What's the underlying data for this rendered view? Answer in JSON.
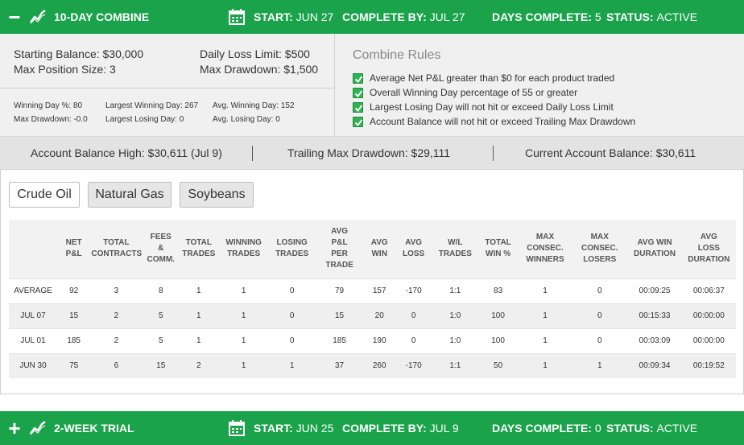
{
  "combine": {
    "title": "10-DAY COMBINE",
    "toggle_icon": "minus",
    "start_label": "START:",
    "start_value": "JUN 27",
    "complete_label": "COMPLETE BY:",
    "complete_value": "JUL 27",
    "days_label": "DAYS COMPLETE:",
    "days_value": "5",
    "status_label": "STATUS:",
    "status_value": "ACTIVE",
    "accent_color": "#1aa34a"
  },
  "summary": {
    "starting_balance": "Starting Balance: $30,000",
    "max_position_size": "Max Position Size: 3",
    "daily_loss_limit": "Daily Loss Limit: $500",
    "max_drawdown": "Max Drawdown: $1,500",
    "winning_day_pct": "Winning Day %: 80",
    "max_drawdown_small": "Max Drawdown: -0.0",
    "largest_winning_day": "Largest Winning Day: 267",
    "largest_losing_day": "Largest Losing Day: 0",
    "avg_winning_day": "Avg. Winning Day: 152",
    "avg_losing_day": "Avg. Losing Day: 0"
  },
  "rules": {
    "title": "Combine Rules",
    "items": [
      "Average Net P&L greater than $0 for each product traded",
      "Overall Winning Day percentage of 55 or greater",
      "Largest Losing Day will not hit or exceed Daily Loss Limit",
      "Account Balance will not hit or exceed Trailing Max Drawdown"
    ]
  },
  "balances": {
    "high": "Account Balance High: $30,611 (Jul 9)",
    "trailing": "Trailing Max Drawdown: $29,111",
    "current": "Current Account Balance: $30,611"
  },
  "products": [
    "Crude Oil",
    "Natural Gas",
    "Soybeans"
  ],
  "table": {
    "headers": [
      [
        "",
        ""
      ],
      [
        "NET",
        "P&L"
      ],
      [
        "TOTAL",
        "CONTRACTS"
      ],
      [
        "FEES",
        "&",
        "COMM."
      ],
      [
        "TOTAL",
        "TRADES"
      ],
      [
        "WINNING",
        "TRADES"
      ],
      [
        "LOSING",
        "TRADES"
      ],
      [
        "AVG",
        "P&L",
        "PER",
        "TRADE"
      ],
      [
        "AVG",
        "WIN"
      ],
      [
        "AVG",
        "LOSS"
      ],
      [
        "W/L",
        "TRADES"
      ],
      [
        "TOTAL",
        "WIN %"
      ],
      [
        "MAX",
        "CONSEC.",
        "WINNERS"
      ],
      [
        "MAX",
        "CONSEC.",
        "LOSERS"
      ],
      [
        "AVG WIN",
        "DURATION"
      ],
      [
        "AVG",
        "LOSS",
        "DURATION"
      ]
    ],
    "rows": [
      [
        "AVERAGE",
        "92",
        "3",
        "8",
        "1",
        "1",
        "0",
        "79",
        "157",
        "-170",
        "1:1",
        "83",
        "1",
        "0",
        "00:09:25",
        "00:06:37"
      ],
      [
        "JUL 07",
        "15",
        "2",
        "5",
        "1",
        "1",
        "0",
        "15",
        "20",
        "0",
        "1:0",
        "100",
        "1",
        "0",
        "00:15:33",
        "00:00:00"
      ],
      [
        "JUL 01",
        "185",
        "2",
        "5",
        "1",
        "1",
        "0",
        "185",
        "190",
        "0",
        "1:0",
        "100",
        "1",
        "0",
        "00:03:09",
        "00:00:00"
      ],
      [
        "JUN 30",
        "75",
        "6",
        "15",
        "2",
        "1",
        "1",
        "37",
        "260",
        "-170",
        "1:1",
        "50",
        "1",
        "1",
        "00:09:34",
        "00:19:52"
      ]
    ]
  },
  "trial": {
    "title": "2-WEEK TRIAL",
    "toggle_icon": "plus",
    "start_label": "START:",
    "start_value": "JUN 25",
    "complete_label": "COMPLETE BY:",
    "complete_value": "JUL 9",
    "days_label": "DAYS COMPLETE:",
    "days_value": "0",
    "status_label": "STATUS:",
    "status_value": "ACTIVE"
  },
  "icons": {
    "trend": "trend-line-icon",
    "calendar": "calendar-icon",
    "check": "checkbox-checked-icon"
  }
}
